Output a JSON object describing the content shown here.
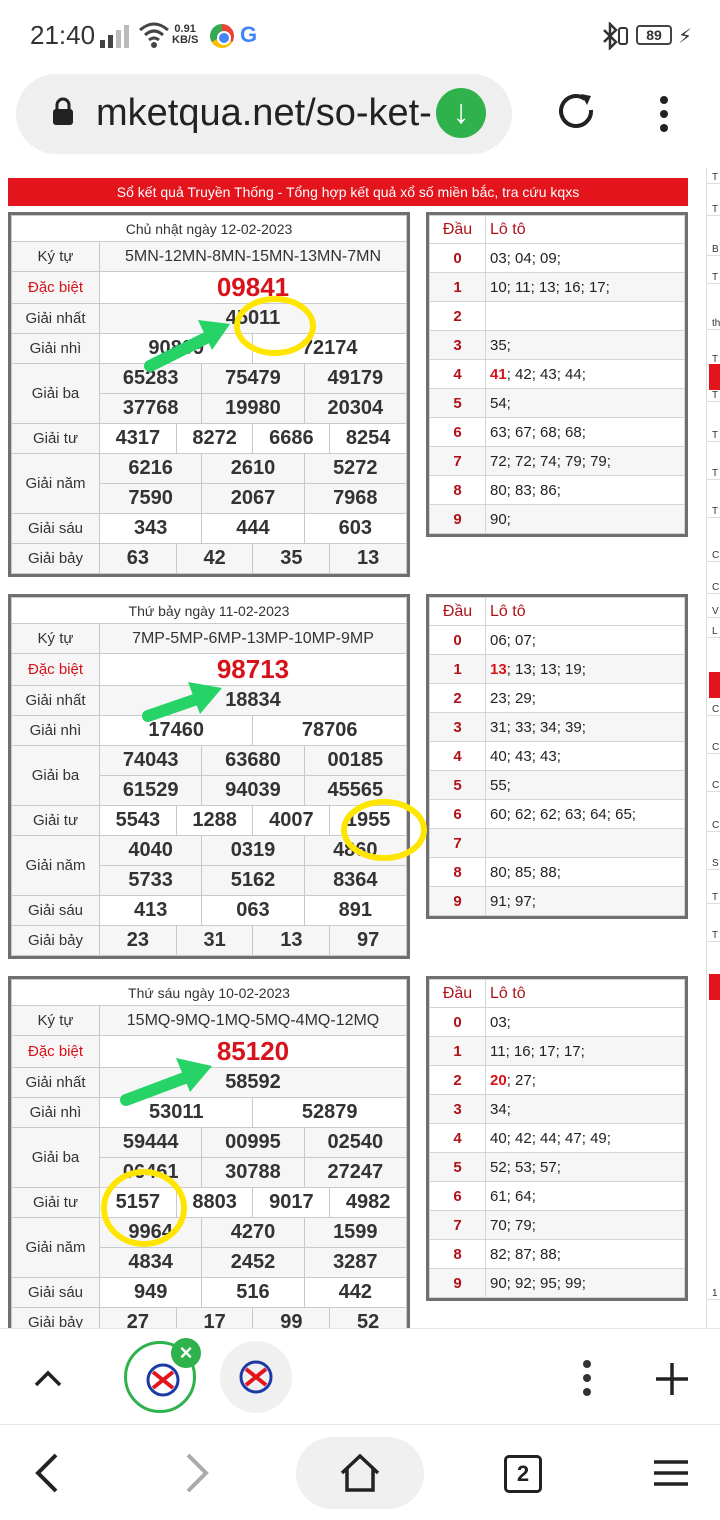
{
  "status": {
    "time": "21:40",
    "speed_top": "0.91",
    "speed_unit": "KB/S",
    "battery": "89"
  },
  "browser": {
    "url": "mketqua.net/so-ket-",
    "open_tab_count": "2"
  },
  "banner": "Sổ kết quả Truyền Thống - Tổng hợp kết quả xổ số miền bắc, tra cứu kqxs",
  "labels": {
    "ky_tu": "Ký tự",
    "dac_biet": "Đặc biệt",
    "giai_nhat": "Giải nhất",
    "giai_nhi": "Giải nhì",
    "giai_ba": "Giải ba",
    "giai_tu": "Giải tư",
    "giai_nam": "Giải năm",
    "giai_sau": "Giải sáu",
    "giai_bay": "Giải bảy",
    "dau": "Đầu",
    "loto": "Lô tô"
  },
  "results": [
    {
      "date": "Chủ nhật ngày 12-02-2023",
      "ky_tu": "5MN-12MN-8MN-15MN-13MN-7MN",
      "dac_biet": "09841",
      "giai_nhat": "45011",
      "giai_nhi": [
        "90809",
        "72174"
      ],
      "giai_ba": [
        "65283",
        "75479",
        "49179",
        "37768",
        "19980",
        "20304"
      ],
      "giai_tu": [
        "4317",
        "8272",
        "6686",
        "8254"
      ],
      "giai_nam": [
        "6216",
        "2610",
        "5272",
        "7590",
        "2067",
        "7968"
      ],
      "giai_sau": [
        "343",
        "444",
        "603"
      ],
      "giai_bay": [
        "63",
        "42",
        "35",
        "13"
      ],
      "loto": [
        {
          "dau": "0",
          "pre": "",
          "special": "",
          "rest": "03; 04; 09;"
        },
        {
          "dau": "1",
          "pre": "",
          "special": "",
          "rest": "10; 11; 13; 16; 17;"
        },
        {
          "dau": "2",
          "pre": "",
          "special": "",
          "rest": ""
        },
        {
          "dau": "3",
          "pre": "",
          "special": "",
          "rest": "35;"
        },
        {
          "dau": "4",
          "pre": "",
          "special": "41",
          "rest": "; 42; 43; 44;"
        },
        {
          "dau": "5",
          "pre": "",
          "special": "",
          "rest": "54;"
        },
        {
          "dau": "6",
          "pre": "",
          "special": "",
          "rest": "63; 67; 68; 68;"
        },
        {
          "dau": "7",
          "pre": "",
          "special": "",
          "rest": "72; 72; 74; 79; 79;"
        },
        {
          "dau": "8",
          "pre": "",
          "special": "",
          "rest": "80; 83; 86;"
        },
        {
          "dau": "9",
          "pre": "",
          "special": "",
          "rest": "90;"
        }
      ]
    },
    {
      "date": "Thứ bảy ngày 11-02-2023",
      "ky_tu": "7MP-5MP-6MP-13MP-10MP-9MP",
      "dac_biet": "98713",
      "giai_nhat": "18834",
      "giai_nhi": [
        "17460",
        "78706"
      ],
      "giai_ba": [
        "74043",
        "63680",
        "00185",
        "61529",
        "94039",
        "45565"
      ],
      "giai_tu": [
        "5543",
        "1288",
        "4007",
        "1955"
      ],
      "giai_nam": [
        "4040",
        "0319",
        "4860",
        "5733",
        "5162",
        "8364"
      ],
      "giai_sau": [
        "413",
        "063",
        "891"
      ],
      "giai_bay": [
        "23",
        "31",
        "13",
        "97"
      ],
      "loto": [
        {
          "dau": "0",
          "pre": "",
          "special": "",
          "rest": "06; 07;"
        },
        {
          "dau": "1",
          "pre": "",
          "special": "13",
          "rest": "; 13; 13; 19;"
        },
        {
          "dau": "2",
          "pre": "",
          "special": "",
          "rest": "23; 29;"
        },
        {
          "dau": "3",
          "pre": "",
          "special": "",
          "rest": "31; 33; 34; 39;"
        },
        {
          "dau": "4",
          "pre": "",
          "special": "",
          "rest": "40; 43; 43;"
        },
        {
          "dau": "5",
          "pre": "",
          "special": "",
          "rest": "55;"
        },
        {
          "dau": "6",
          "pre": "",
          "special": "",
          "rest": "60; 62; 62; 63; 64; 65;"
        },
        {
          "dau": "7",
          "pre": "",
          "special": "",
          "rest": ""
        },
        {
          "dau": "8",
          "pre": "",
          "special": "",
          "rest": "80; 85; 88;"
        },
        {
          "dau": "9",
          "pre": "",
          "special": "",
          "rest": "91; 97;"
        }
      ]
    },
    {
      "date": "Thứ sáu ngày 10-02-2023",
      "ky_tu": "15MQ-9MQ-1MQ-5MQ-4MQ-12MQ",
      "dac_biet": "85120",
      "giai_nhat": "58592",
      "giai_nhi": [
        "53011",
        "52879"
      ],
      "giai_ba": [
        "59444",
        "00995",
        "02540",
        "06461",
        "30788",
        "27247"
      ],
      "giai_tu": [
        "5157",
        "8803",
        "9017",
        "4982"
      ],
      "giai_nam": [
        "9964",
        "4270",
        "1599",
        "4834",
        "2452",
        "3287"
      ],
      "giai_sau": [
        "949",
        "516",
        "442"
      ],
      "giai_bay": [
        "27",
        "17",
        "99",
        "52"
      ],
      "loto": [
        {
          "dau": "0",
          "pre": "",
          "special": "",
          "rest": "03;"
        },
        {
          "dau": "1",
          "pre": "",
          "special": "",
          "rest": "11; 16; 17; 17;"
        },
        {
          "dau": "2",
          "pre": "",
          "special": "20",
          "rest": "; 27;"
        },
        {
          "dau": "3",
          "pre": "",
          "special": "",
          "rest": "34;"
        },
        {
          "dau": "4",
          "pre": "",
          "special": "",
          "rest": "40; 42; 44; 47; 49;"
        },
        {
          "dau": "5",
          "pre": "",
          "special": "",
          "rest": "52; 53; 57;"
        },
        {
          "dau": "6",
          "pre": "",
          "special": "",
          "rest": "61; 64;"
        },
        {
          "dau": "7",
          "pre": "",
          "special": "",
          "rest": "70; 79;"
        },
        {
          "dau": "8",
          "pre": "",
          "special": "",
          "rest": "82; 87; 88;"
        },
        {
          "dau": "9",
          "pre": "",
          "special": "",
          "rest": "90; 92; 95; 99;"
        }
      ]
    }
  ],
  "sidebar_letters": [
    "T",
    "T",
    "B",
    "T",
    "th",
    "T",
    "T",
    "T",
    "T",
    "T",
    "C",
    "C",
    "V",
    "L",
    "C",
    "C",
    "C",
    "C",
    "S",
    "T",
    "T",
    "1"
  ],
  "colors": {
    "accent_red": "#e3141b",
    "number_red": "#d8121a",
    "green_arrow": "#25d366",
    "yellow_circle": "#ffe600",
    "tab_green": "#2fb24c"
  },
  "icons": [
    "signal-icon",
    "wifi-icon",
    "chrome-icon",
    "google-icon",
    "bluetooth-icon",
    "battery-icon",
    "lock-icon",
    "download-icon",
    "reload-icon",
    "more-vert-icon",
    "chevron-up-icon",
    "close-icon",
    "plus-icon",
    "back-icon",
    "forward-icon",
    "home-icon",
    "tabs-icon",
    "menu-icon"
  ]
}
